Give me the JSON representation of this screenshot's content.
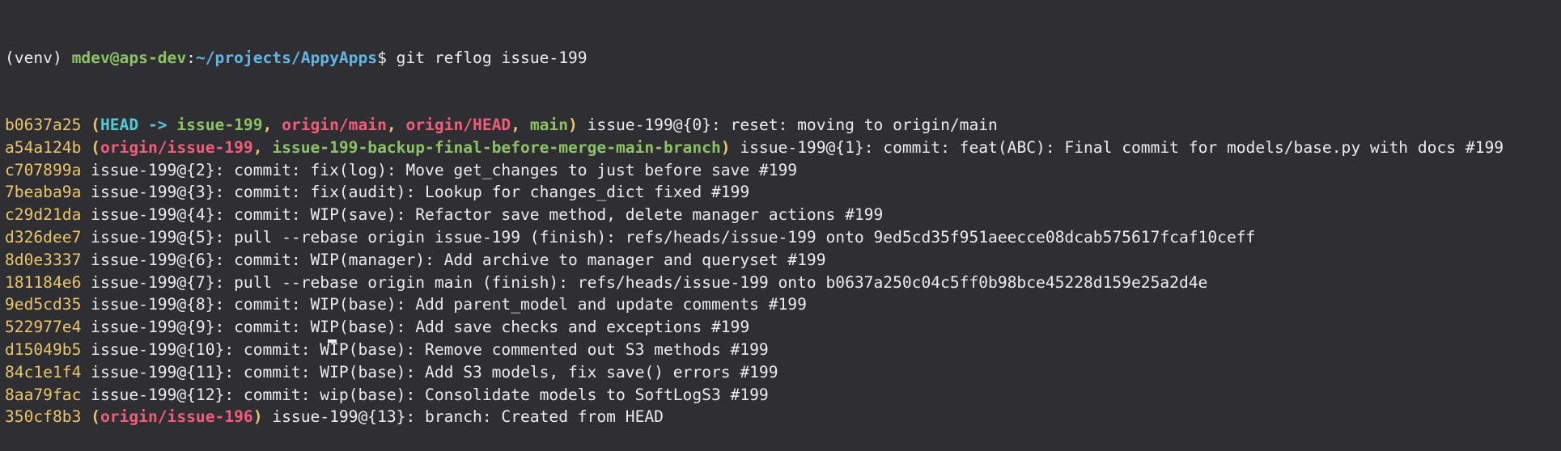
{
  "prompt": {
    "venv": "(venv) ",
    "userhost": "mdev@aps-dev",
    "colon": ":",
    "path": "~/projects/AppyApps",
    "dollar": "$ ",
    "command": "git reflog issue-199"
  },
  "colors": {
    "background": "#2f2e33",
    "text": "#ececec",
    "green": "#8cc265",
    "blue": "#61b6e4",
    "yellow": "#e9c66b",
    "red": "#ef5d79",
    "cyan": "#56c8d6"
  },
  "entries": [
    {
      "hash": "b0637a25",
      "refs": [
        {
          "t": " (",
          "c": "c-ybold"
        },
        {
          "t": "HEAD -> ",
          "c": "c-cyan"
        },
        {
          "t": "issue-199",
          "c": "c-gbold"
        },
        {
          "t": ", ",
          "c": "c-ybold"
        },
        {
          "t": "origin/main",
          "c": "c-red"
        },
        {
          "t": ", ",
          "c": "c-ybold"
        },
        {
          "t": "origin/HEAD",
          "c": "c-red"
        },
        {
          "t": ", ",
          "c": "c-ybold"
        },
        {
          "t": "main",
          "c": "c-gbold"
        },
        {
          "t": ")",
          "c": "c-ybold"
        }
      ],
      "message": " issue-199@{0}: reset: moving to origin/main"
    },
    {
      "hash": "a54a124b",
      "refs": [
        {
          "t": " (",
          "c": "c-ybold"
        },
        {
          "t": "origin/issue-199",
          "c": "c-red"
        },
        {
          "t": ", ",
          "c": "c-ybold"
        },
        {
          "t": "issue-199-backup-final-before-merge-main-branch",
          "c": "c-gbold"
        },
        {
          "t": ")",
          "c": "c-ybold"
        }
      ],
      "message": " issue-199@{1}: commit: feat(ABC): Final commit for models/base.py with docs #199"
    },
    {
      "hash": "c707899a",
      "refs": [],
      "message": " issue-199@{2}: commit: fix(log): Move get_changes to just before save #199"
    },
    {
      "hash": "7beaba9a",
      "refs": [],
      "message": " issue-199@{3}: commit: fix(audit): Lookup for changes_dict fixed #199"
    },
    {
      "hash": "c29d21da",
      "refs": [],
      "message": " issue-199@{4}: commit: WIP(save): Refactor save method, delete manager actions #199"
    },
    {
      "hash": "d326dee7",
      "refs": [],
      "message": " issue-199@{5}: pull --rebase origin issue-199 (finish): refs/heads/issue-199 onto 9ed5cd35f951aeecce08dcab575617fcaf10ceff"
    },
    {
      "hash": "8d0e3337",
      "refs": [],
      "message": " issue-199@{6}: commit: WIP(manager): Add archive to manager and queryset #199"
    },
    {
      "hash": "181184e6",
      "refs": [],
      "message": " issue-199@{7}: pull --rebase origin main (finish): refs/heads/issue-199 onto b0637a250c04c5ff0b98bce45228d159e25a2d4e"
    },
    {
      "hash": "9ed5cd35",
      "refs": [],
      "message": " issue-199@{8}: commit: WIP(base): Add parent_model and update comments #199"
    },
    {
      "hash": "522977e4",
      "refs": [],
      "message": " issue-199@{9}: commit: WIP(base): Add save checks and exceptions #199"
    },
    {
      "hash": "d15049b5",
      "refs": [],
      "message": " issue-199@{10}: commit: WIP(base): Remove commented out S3 methods #199"
    },
    {
      "hash": "84c1e1f4",
      "refs": [],
      "message": " issue-199@{11}: commit: WIP(base): Add S3 models, fix save() errors #199"
    },
    {
      "hash": "8aa79fac",
      "refs": [],
      "message": " issue-199@{12}: commit: wip(base): Consolidate models to SoftLogS3 #199"
    },
    {
      "hash": "350cf8b3",
      "refs": [
        {
          "t": " (",
          "c": "c-ybold"
        },
        {
          "t": "origin/issue-196",
          "c": "c-red"
        },
        {
          "t": ")",
          "c": "c-ybold"
        }
      ],
      "message": " issue-199@{13}: branch: Created from HEAD"
    }
  ]
}
